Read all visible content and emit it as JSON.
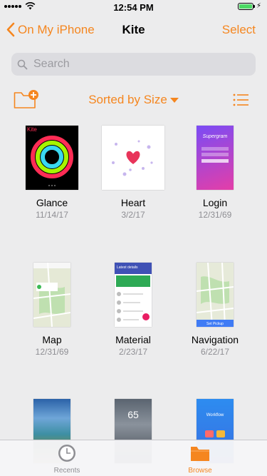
{
  "status_bar": {
    "time": "12:54 PM"
  },
  "nav": {
    "back_label": "On My iPhone",
    "title": "Kite",
    "select_label": "Select"
  },
  "search": {
    "placeholder": "Search"
  },
  "toolbar": {
    "sort_label": "Sorted by Size"
  },
  "files": [
    {
      "name": "Glance",
      "date": "11/14/17",
      "thumb_text": "Kite"
    },
    {
      "name": "Heart",
      "date": "3/2/17"
    },
    {
      "name": "Login",
      "date": "12/31/69",
      "thumb_text": "Supergram"
    },
    {
      "name": "Map",
      "date": "12/31/69"
    },
    {
      "name": "Material",
      "date": "2/23/17",
      "thumb_text": "Latest details"
    },
    {
      "name": "Navigation",
      "date": "6/22/17",
      "thumb_text": "Set Pickup"
    },
    {
      "name": "",
      "date": ""
    },
    {
      "name": "",
      "date": "",
      "thumb_text": "65"
    },
    {
      "name": "",
      "date": "",
      "thumb_text": "Workflow"
    }
  ],
  "tabs": [
    {
      "label": "Recents",
      "icon": "clock-icon"
    },
    {
      "label": "Browse",
      "icon": "folder-icon"
    }
  ],
  "colors": {
    "accent": "#f5861f",
    "background": "#ececed",
    "battery": "#4cd964"
  }
}
